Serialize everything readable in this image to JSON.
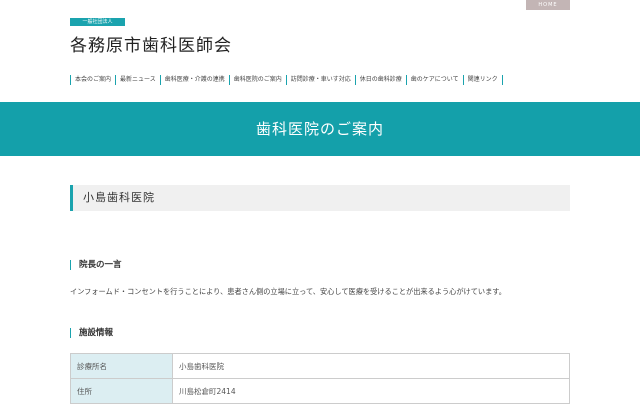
{
  "header": {
    "home_label": "HOME",
    "badge": "一般社団法人",
    "site_title": "各務原市歯科医師会"
  },
  "nav": [
    "本会のご案内",
    "最新ニュース",
    "歯科医療・介護の連携",
    "歯科医院のご案内",
    "訪問診療・車いす対応",
    "休日の歯科診療",
    "歯のケアについて",
    "関連リンク"
  ],
  "page_title": "歯科医院のご案内",
  "clinic_name": "小島歯科医院",
  "sections": {
    "message_heading": "院長の一言",
    "message": "インフォームド・コンセントを行うことにより、患者さん側の立場に立って、安心して医療を受けることが出来るよう心がけています。",
    "facility_heading": "施設情報"
  },
  "facility": [
    {
      "label": "診療所名",
      "value": "小島歯科医院"
    },
    {
      "label": "住所",
      "value": "川島松倉町2414"
    }
  ]
}
